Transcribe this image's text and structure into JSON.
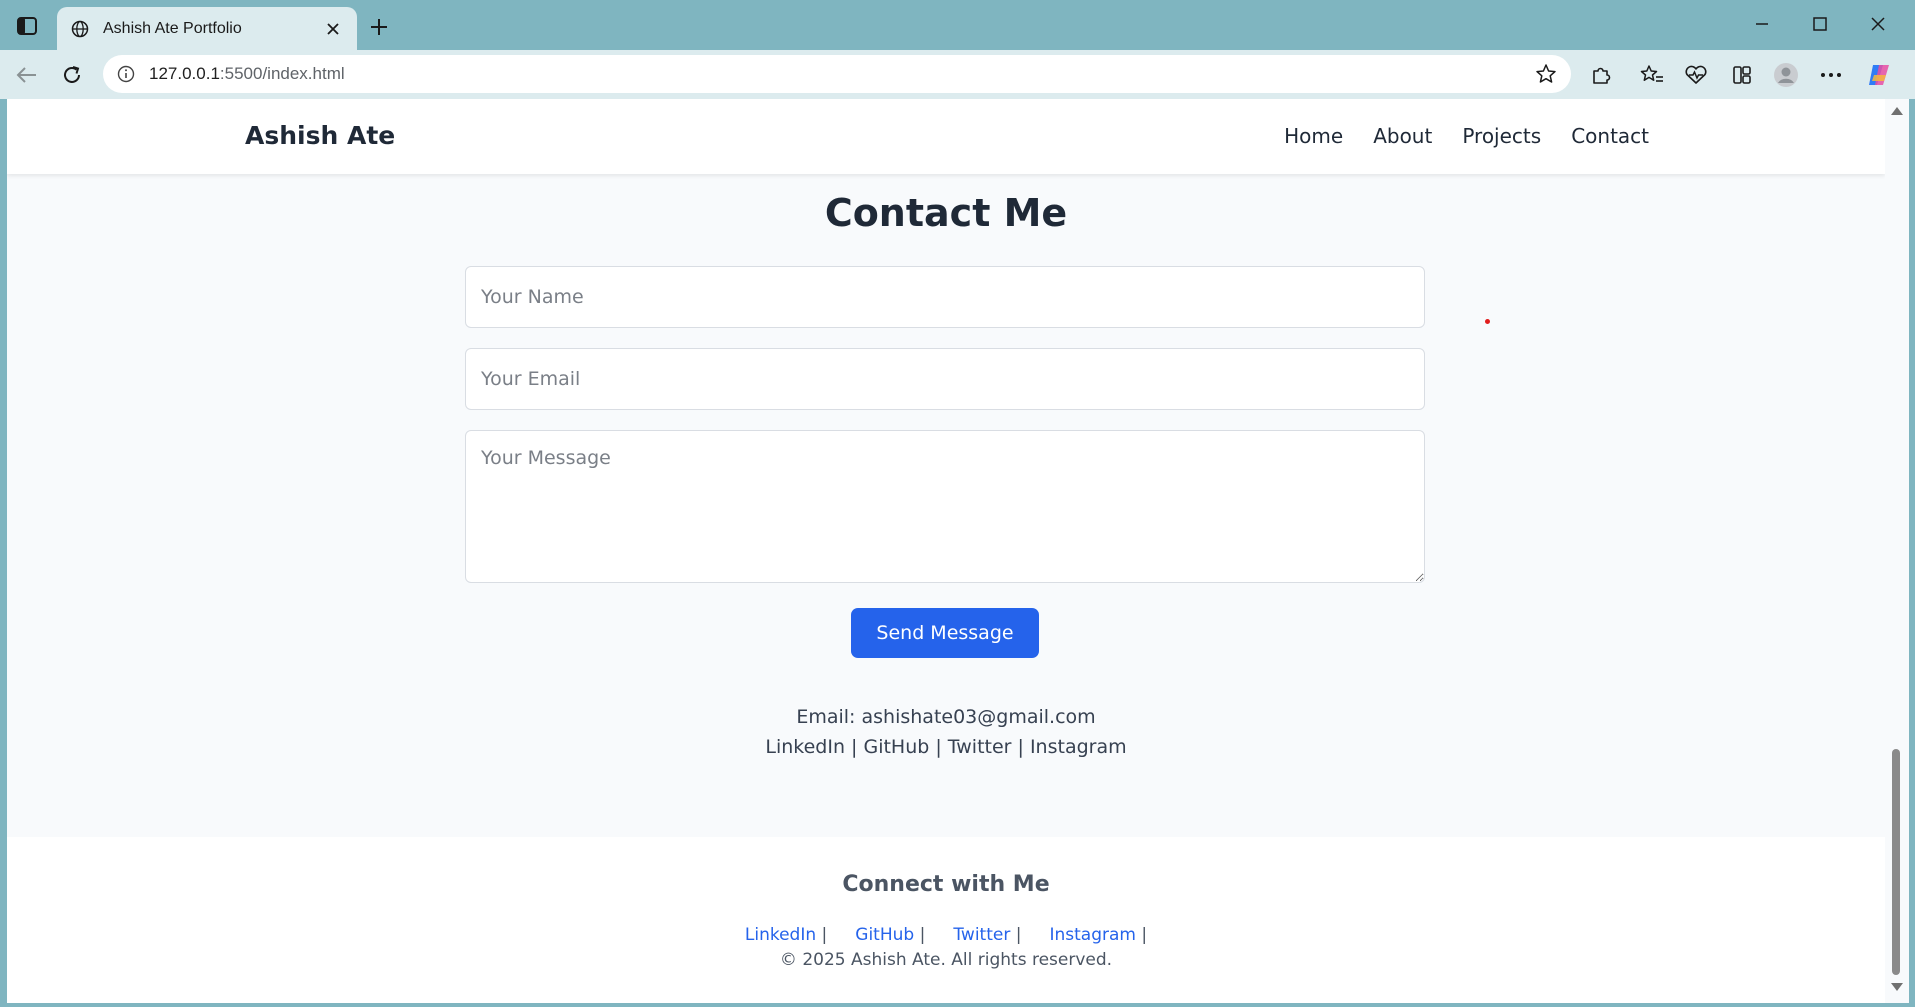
{
  "browser": {
    "tab_title": "Ashish Ate Portfolio",
    "url_host": "127.0.0.1",
    "url_path": ":5500/index.html"
  },
  "nav": {
    "brand": "Ashish Ate",
    "links": [
      "Home",
      "About",
      "Projects",
      "Contact"
    ]
  },
  "contact": {
    "title": "Contact Me",
    "name_placeholder": "Your Name",
    "email_placeholder": "Your Email",
    "message_placeholder": "Your Message",
    "send_label": "Send Message",
    "email_line": "Email: ashishate03@gmail.com",
    "social_line": "LinkedIn | GitHub | Twitter | Instagram"
  },
  "footer": {
    "title": "Connect with Me",
    "links": [
      "LinkedIn",
      "GitHub",
      "Twitter",
      "Instagram"
    ],
    "separator": "|",
    "copyright": "© 2025 Ashish Ate. All rights reserved."
  },
  "colors": {
    "accent": "#2563eb",
    "chrome": "#7fb5c0",
    "toolbar": "#dcebee",
    "page_bg": "#f8fafc"
  }
}
